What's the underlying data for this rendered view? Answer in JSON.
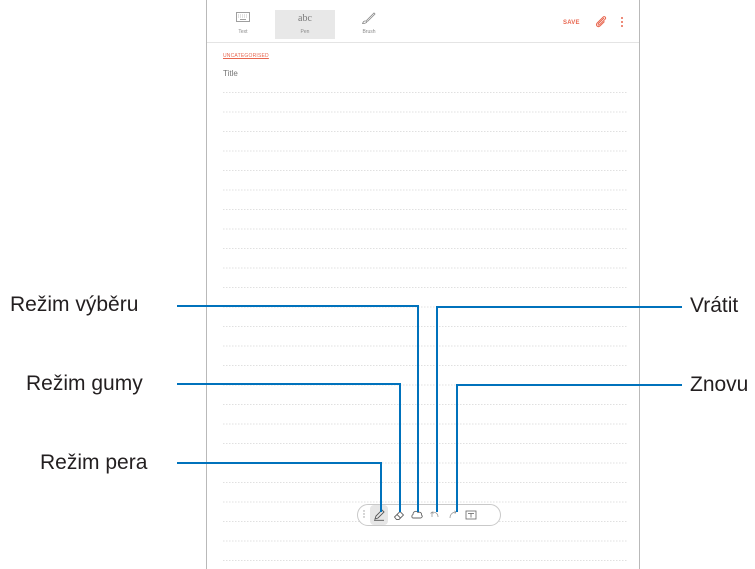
{
  "toolbar": {
    "modes": [
      {
        "label": "Text",
        "icon": "keyboard-icon"
      },
      {
        "label": "Pen",
        "icon_text": "abc"
      },
      {
        "label": "Brush",
        "icon": "brush-icon"
      }
    ],
    "save_label": "SAVE"
  },
  "note": {
    "category": "UNCATEGORISED",
    "title_placeholder": "Title"
  },
  "penbar": {
    "tools": [
      "pen-mode-icon",
      "eraser-mode-icon",
      "selection-mode-icon",
      "undo-icon",
      "redo-icon",
      "text-format-icon"
    ]
  },
  "callouts": {
    "selection_mode": "Režim výběru",
    "eraser_mode": "Režim gumy",
    "pen_mode": "Režim pera",
    "undo": "Vrátit",
    "redo": "Znovu"
  },
  "colors": {
    "accent": "#e8664f",
    "leader": "#0072bc"
  }
}
